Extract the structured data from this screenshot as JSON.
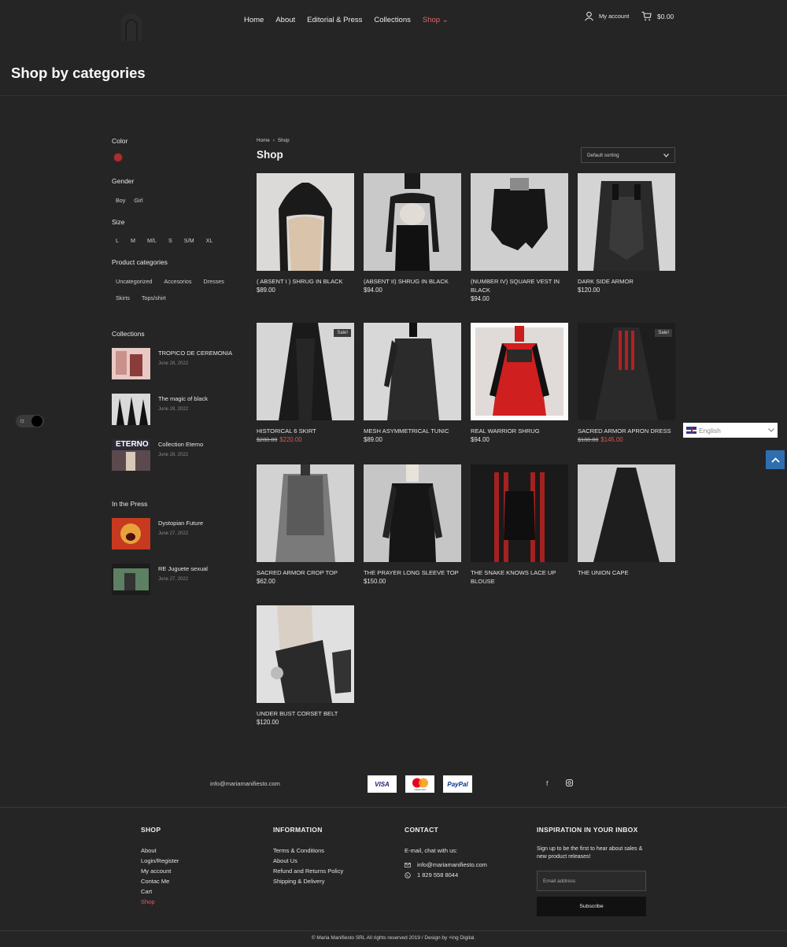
{
  "header": {
    "nav": [
      "Home",
      "About",
      "Editorial & Press",
      "Collections",
      "Shop"
    ],
    "nav_active_caret": "⌄",
    "account_label": "My account",
    "cart_total": "$0.00",
    "page_title": "Shop by categories"
  },
  "sidebar": {
    "color_heading": "Color",
    "swatch_color": "#a8302f",
    "gender_heading": "Gender",
    "genders": [
      "Boy",
      "Girl"
    ],
    "size_heading": "Size",
    "sizes": [
      "L",
      "M",
      "M/L",
      "S",
      "S/M",
      "XL"
    ],
    "categories_heading": "Product categories",
    "categories": [
      "Uncategorized",
      "Accesorios",
      "Dresses",
      "Skirts",
      "Tops/shirt"
    ],
    "collections_heading": "Collections",
    "collections": [
      {
        "title": "TROPICO DE CEREMONIA",
        "date": "June 28, 2022"
      },
      {
        "title": "The magic of black",
        "date": "June 28, 2022"
      },
      {
        "title": "Collection Eterno",
        "date": "June 28, 2022",
        "thumb_text": "ETERNO"
      }
    ],
    "press_heading": "In the Press",
    "press": [
      {
        "title": "Dystopian Future",
        "date": "June 27, 2022"
      },
      {
        "title": "RE Juguete sexual",
        "date": "June 27, 2022"
      }
    ]
  },
  "shop": {
    "breadcrumb": [
      "Home",
      "›",
      "Shop"
    ],
    "heading": "Shop",
    "sorting": "Default sorting",
    "sale_badge": "Sale!",
    "products": [
      {
        "name": "( ABSENT I ) SHRUG IN BLACK",
        "price": "$89.00"
      },
      {
        "name": "(ABSENT II) SHRUG IN BLACK",
        "price": "$94.00"
      },
      {
        "name": "(NUMBER IV) SQUARE VEST IN BLACK",
        "price": "$94.00"
      },
      {
        "name": "DARK SIDE ARMOR",
        "price": "$120.00"
      },
      {
        "name": "HISTORICAL 6 SKIRT",
        "old_price": "$280.00",
        "price": "$220.00",
        "sale": true
      },
      {
        "name": "MESH ASYMMETRICAL TUNIC",
        "price": "$89.00"
      },
      {
        "name": "REAL WARRIOR SHRUG",
        "price": "$94.00"
      },
      {
        "name": "SACRED ARMOR APRON DRESS",
        "old_price": "$180.00",
        "price": "$145.00",
        "sale": true
      },
      {
        "name": "SACRED ARMOR CROP TOP",
        "price": "$62.00"
      },
      {
        "name": "THE PRAYER LONG SLEEVE TOP",
        "price": "$150.00"
      },
      {
        "name": "THE SNAKE KNOWS LACE UP BLOUSE",
        "price": ""
      },
      {
        "name": "THE UNION CAPE",
        "price": ""
      },
      {
        "name": "UNDER BUST CORSET BELT",
        "price": "$120.00"
      }
    ]
  },
  "widgets": {
    "language": "English",
    "theme_icon": "sun-icon",
    "to_top_icon": "chevron-up-icon"
  },
  "payments": {
    "email": "info@mariamanifiesto.com",
    "cards": [
      "VISA",
      "mastercard",
      "PayPal"
    ]
  },
  "footer": {
    "shop_heading": "SHOP",
    "shop_links": [
      "About",
      "Login/Register",
      "My account",
      "Contac Me",
      "Cart",
      "Shop"
    ],
    "info_heading": "INFORMATION",
    "info_links": [
      "Terms & Conditions",
      "About Us",
      "Refund and Returns Policy",
      "Shipping & Delivery"
    ],
    "contact_heading": "CONTACT",
    "contact_intro": "E-mail, chat with us:",
    "contact_email": "info@mariamanifiesto.com",
    "contact_phone": "1 829 558 8044",
    "newsletter_heading": "INSPIRATION IN YOUR INBOX",
    "newsletter_text": "Sign up to be the first to hear about sales & new product releases!",
    "email_placeholder": "Email address",
    "subscribe_label": "Subscribe",
    "copyright": "© Maria Manifiesto SRL All rights reserved 2019 / Design by +ing Digital."
  }
}
